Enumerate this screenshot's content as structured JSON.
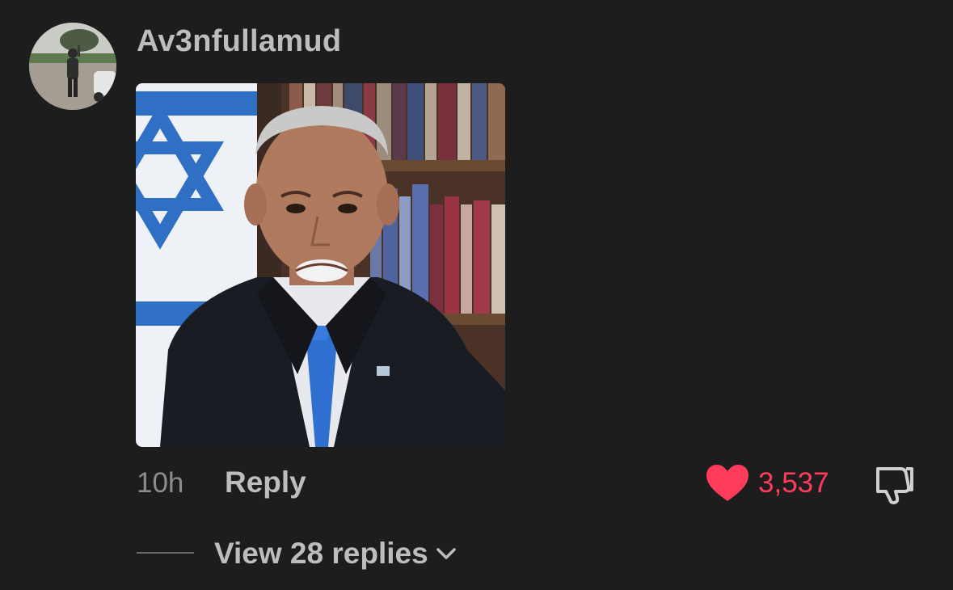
{
  "comment": {
    "username": "Av3nfullamud",
    "timestamp": "10h",
    "reply_label": "Reply",
    "like_count": "3,537",
    "replies_label": "View 28 replies"
  },
  "icons": {
    "like": "heart-icon",
    "dislike": "thumbs-down-icon",
    "expand": "chevron-down-icon"
  },
  "colors": {
    "background": "#1d1d1d",
    "like_accent": "#ff3b5c",
    "primary_text": "#bdbdbd",
    "secondary_text": "#8c8c8c"
  }
}
